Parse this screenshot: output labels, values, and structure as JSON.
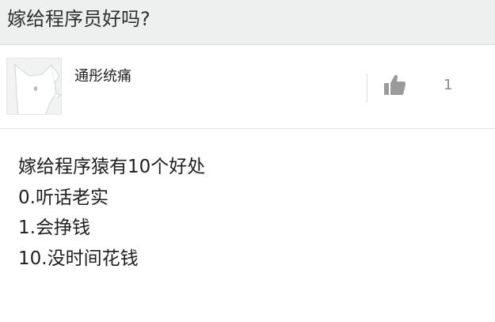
{
  "question": {
    "title": "嫁给程序员好吗?"
  },
  "answer": {
    "author": {
      "name": "通彤统痛",
      "avatar_icon": "dog-avatar-icon"
    },
    "vote": {
      "icon": "thumbs-up-icon",
      "count": "1"
    },
    "lines": [
      "嫁给程序猿有10个好处",
      "0.听话老实",
      "1.会挣钱",
      "10.没时间花钱"
    ]
  },
  "colors": {
    "header_background": "#eef0f0",
    "text_primary": "#1f1f1f",
    "text_muted": "#8a8a8a",
    "icon_gray": "#9a9a9a"
  }
}
